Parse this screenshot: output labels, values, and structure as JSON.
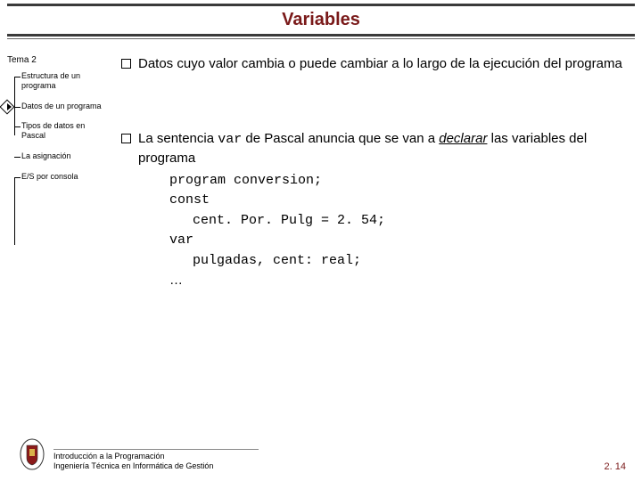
{
  "title": "Variables",
  "sidebar": {
    "root": "Tema 2",
    "items": [
      {
        "label": "Estructura de un programa",
        "active": false
      },
      {
        "label": "Datos de un programa",
        "active": true
      },
      {
        "label": "Tipos de datos en Pascal",
        "active": false
      },
      {
        "label": "La asignación",
        "active": false
      },
      {
        "label": "E/S por consola",
        "active": false
      }
    ]
  },
  "content": {
    "bullet1": "Datos cuyo valor cambia o puede cambiar a lo largo de la ejecución del programa",
    "bullet2_pre": "La sentencia ",
    "bullet2_kw": "var",
    "bullet2_mid": " de Pascal anuncia que se van a ",
    "bullet2_decl": "declarar",
    "bullet2_post": " las variables del programa",
    "code": {
      "l1": "program conversion;",
      "l2": "const",
      "l3": "cent. Por. Pulg = 2. 54;",
      "l4": "var",
      "l5": "pulgadas, cent: real;",
      "l6": "…"
    }
  },
  "footer": {
    "line1": "Introducción a la Programación",
    "line2": "Ingeniería Técnica en Informática de Gestión",
    "page": "2. 14"
  }
}
